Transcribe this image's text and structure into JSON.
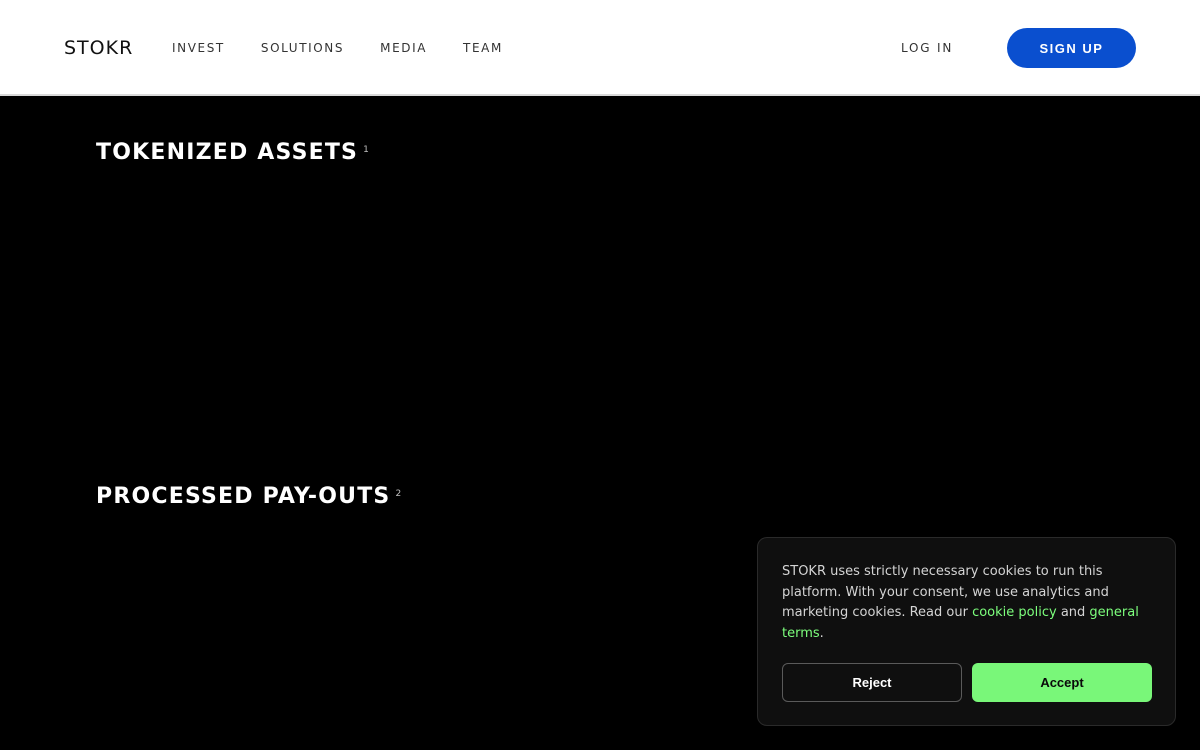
{
  "header": {
    "logo": "STOKR",
    "nav": [
      "INVEST",
      "SOLUTIONS",
      "MEDIA",
      "TEAM"
    ],
    "login_label": "LOG IN",
    "signup_label": "SIGN UP"
  },
  "sections": [
    {
      "title": "TOKENIZED ASSETS",
      "footnote": "1"
    },
    {
      "title": "PROCESSED PAY-OUTS",
      "footnote": "2"
    }
  ],
  "cookie_banner": {
    "text_before": "STOKR uses strictly necessary cookies to run this platform. With your consent, we use analytics and marketing cookies. Read our ",
    "link_cookie_policy": "cookie policy",
    "text_and": " and ",
    "link_general_terms": "general terms",
    "text_end": ".",
    "reject_label": "Reject",
    "accept_label": "Accept"
  },
  "colors": {
    "brand_blue": "#0a4fcf",
    "accent_green": "#79f779",
    "background": "#000000"
  }
}
